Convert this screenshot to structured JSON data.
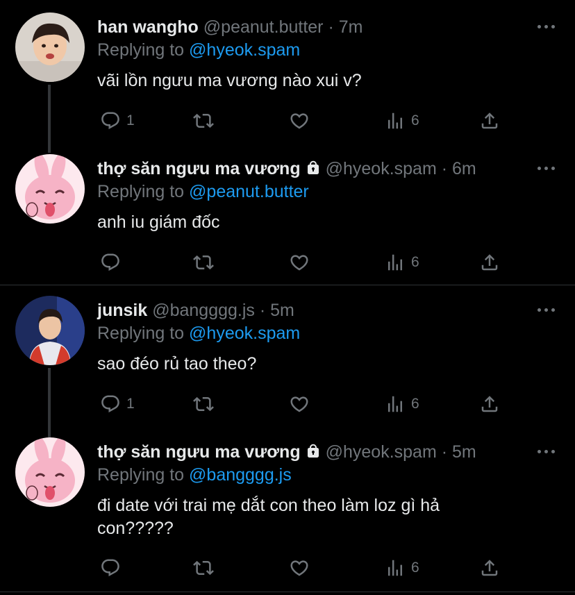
{
  "tweets": [
    {
      "name": "han wangho",
      "handle": "@peanut.butter",
      "time": "7m",
      "replying_prefix": "Replying to",
      "replying_to": "@hyeok.spam",
      "text": "vãi lồn ngưu ma vương nào xui v?",
      "reply_count": "1",
      "views": "6",
      "avatar": "person-photo"
    },
    {
      "name": "thợ săn ngưu ma vương",
      "handle": "@hyeok.spam",
      "time": "6m",
      "replying_prefix": "Replying to",
      "replying_to": "@peanut.butter",
      "text": "anh iu giám đốc",
      "reply_count": "",
      "views": "6",
      "avatar": "pink-bunny"
    },
    {
      "name": "junsik",
      "handle": "@bangggg.js",
      "time": "5m",
      "replying_prefix": "Replying to",
      "replying_to": "@hyeok.spam",
      "text": "sao đéo rủ tao theo?",
      "reply_count": "1",
      "views": "6",
      "avatar": "person-photo"
    },
    {
      "name": "thợ săn ngưu ma vương",
      "handle": "@hyeok.spam",
      "time": "5m",
      "replying_prefix": "Replying to",
      "replying_to": "@bangggg.js",
      "text": "đi date với trai mẹ dắt con theo làm loz gì hả con?????",
      "reply_count": "",
      "views": "6",
      "avatar": "pink-bunny"
    }
  ],
  "separator": "·",
  "colors": {
    "background": "#000000",
    "primary_text": "#e7e9ea",
    "secondary_text": "#71767b",
    "link": "#1d9bf0",
    "divider": "#2f3336"
  },
  "icons": [
    "reply-icon",
    "retweet-icon",
    "like-icon",
    "views-icon",
    "share-icon",
    "more-icon",
    "lock-icon"
  ]
}
